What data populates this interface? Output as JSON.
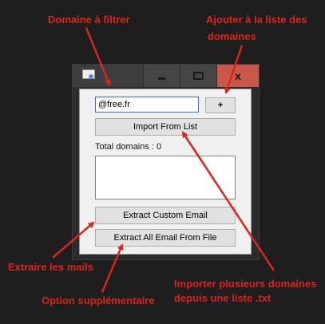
{
  "annotations": {
    "domain_filter": "Domaine à filtrer",
    "add_line1": "Ajouter à la liste des",
    "add_line2": "domaines",
    "extract_mails": "Extraire les mails",
    "extra_option": "Option supplémentaire",
    "import_line1": "Importer plusieurs domaines",
    "import_line2": "depuis une liste .txt",
    "color": "#d9261c"
  },
  "window": {
    "icon": "app-icon",
    "minimize_icon": "minimize-icon",
    "maximize_icon": "maximize-icon",
    "close_label": "x"
  },
  "form": {
    "domain_value": "@free.fr",
    "add_label": "+",
    "import_label": "Import From List",
    "total_text": "Total domains : 0",
    "extract_custom_label": "Extract Custom Email",
    "extract_all_label": "Extract All Email From File"
  }
}
